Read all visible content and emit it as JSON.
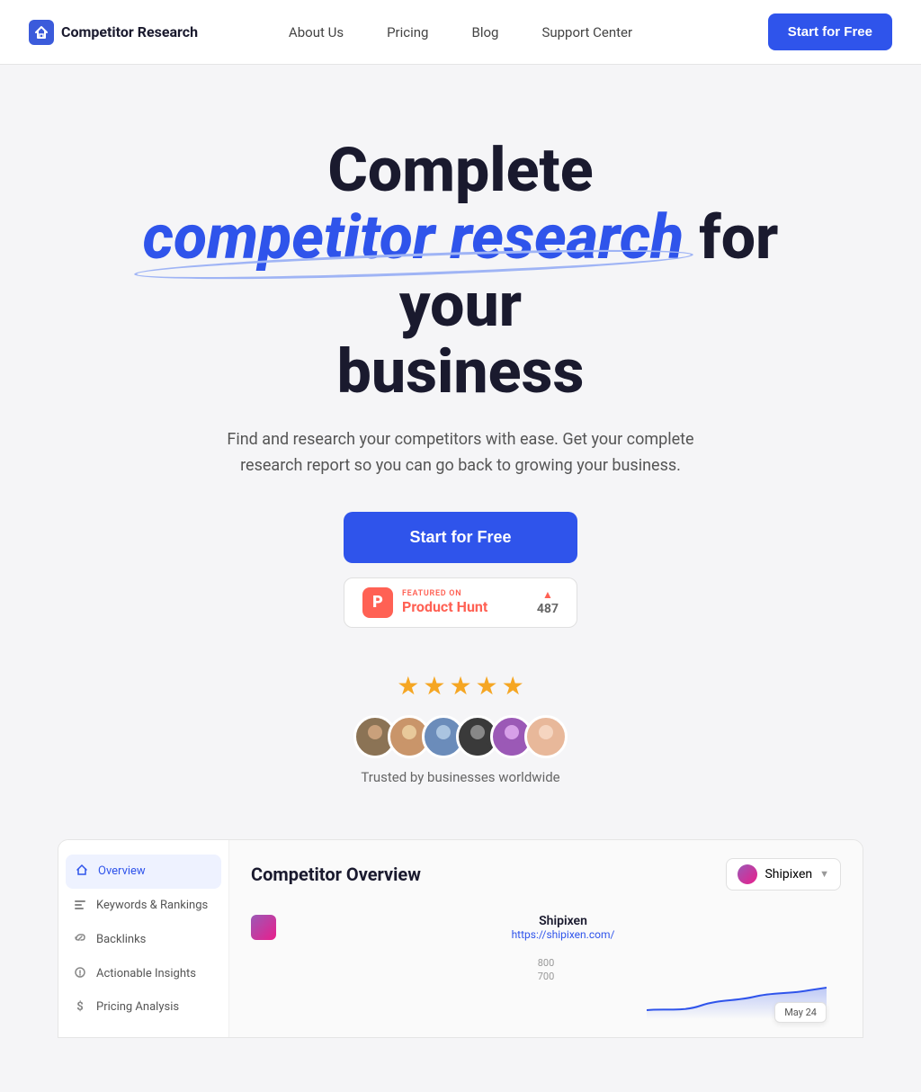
{
  "nav": {
    "logo_text": "Competitor Research",
    "logo_icon": "⚡",
    "links": [
      {
        "label": "About Us",
        "id": "about-us"
      },
      {
        "label": "Pricing",
        "id": "pricing"
      },
      {
        "label": "Blog",
        "id": "blog"
      },
      {
        "label": "Support Center",
        "id": "support-center"
      }
    ],
    "cta_label": "Start for Free"
  },
  "hero": {
    "title_part1": "Complete",
    "title_highlight": "competitor research",
    "title_part2": "for your business",
    "subtitle": "Find and research your competitors with ease. Get your complete research report so you can go back to growing your business.",
    "cta_label": "Start for Free",
    "ph_featured": "FEATURED ON",
    "ph_name": "Product Hunt",
    "ph_count": "487",
    "ph_letter": "P",
    "trust_text": "Trusted by businesses worldwide"
  },
  "stars": [
    "★",
    "★",
    "★",
    "★",
    "★"
  ],
  "preview": {
    "sidebar_items": [
      {
        "label": "Overview",
        "icon": "⚡",
        "active": true
      },
      {
        "label": "Keywords & Rankings",
        "icon": "📊",
        "active": false
      },
      {
        "label": "Backlinks",
        "icon": "🔗",
        "active": false
      },
      {
        "label": "Actionable Insights",
        "icon": "⚙️",
        "active": false
      },
      {
        "label": "Pricing Analysis",
        "icon": "$",
        "active": false
      }
    ],
    "main_title": "Competitor Overview",
    "dropdown_label": "Shipixen",
    "competitor_name": "Shipixen",
    "competitor_url": "https://shipixen.com/",
    "chart_y1": "800",
    "chart_y2": "700",
    "may_label": "May 24"
  }
}
